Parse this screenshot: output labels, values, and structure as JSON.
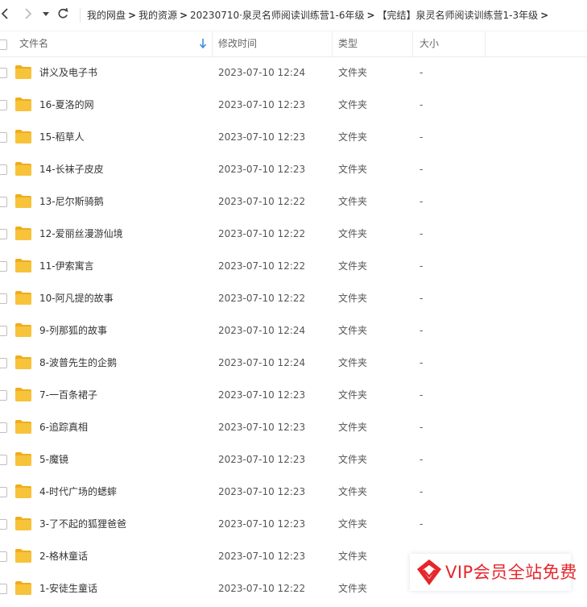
{
  "nav": {
    "back_icon": "chevron-left-icon",
    "forward_icon": "chevron-right-icon",
    "dropdown_icon": "caret-down-icon",
    "refresh_icon": "refresh-icon"
  },
  "breadcrumb": [
    "我的网盘",
    "我的资源",
    "20230710·泉灵名师阅读训练营1-6年级",
    "【完结】泉灵名师阅读训练营1-3年级"
  ],
  "columns": {
    "name": "文件名",
    "modified": "修改时间",
    "type": "类型",
    "size": "大小"
  },
  "rows": [
    {
      "name": "讲义及电子书",
      "modified": "2023-07-10 12:24",
      "type": "文件夹",
      "size": "-"
    },
    {
      "name": "16-夏洛的网",
      "modified": "2023-07-10 12:23",
      "type": "文件夹",
      "size": "-"
    },
    {
      "name": "15-稻草人",
      "modified": "2023-07-10 12:23",
      "type": "文件夹",
      "size": "-"
    },
    {
      "name": "14-长袜子皮皮",
      "modified": "2023-07-10 12:23",
      "type": "文件夹",
      "size": "-"
    },
    {
      "name": "13-尼尔斯骑鹅",
      "modified": "2023-07-10 12:22",
      "type": "文件夹",
      "size": "-"
    },
    {
      "name": "12-爱丽丝漫游仙境",
      "modified": "2023-07-10 12:22",
      "type": "文件夹",
      "size": "-"
    },
    {
      "name": "11-伊索寓言",
      "modified": "2023-07-10 12:22",
      "type": "文件夹",
      "size": "-"
    },
    {
      "name": "10-阿凡提的故事",
      "modified": "2023-07-10 12:22",
      "type": "文件夹",
      "size": "-"
    },
    {
      "name": "9-列那狐的故事",
      "modified": "2023-07-10 12:24",
      "type": "文件夹",
      "size": "-"
    },
    {
      "name": "8-波普先生的企鹅",
      "modified": "2023-07-10 12:24",
      "type": "文件夹",
      "size": "-"
    },
    {
      "name": "7-一百条裙子",
      "modified": "2023-07-10 12:23",
      "type": "文件夹",
      "size": "-"
    },
    {
      "name": "6-追踪真相",
      "modified": "2023-07-10 12:23",
      "type": "文件夹",
      "size": "-"
    },
    {
      "name": "5-魔镜",
      "modified": "2023-07-10 12:23",
      "type": "文件夹",
      "size": "-"
    },
    {
      "name": "4-时代广场的蟋蟀",
      "modified": "2023-07-10 12:23",
      "type": "文件夹",
      "size": "-"
    },
    {
      "name": "3-了不起的狐狸爸爸",
      "modified": "2023-07-10 12:23",
      "type": "文件夹",
      "size": "-"
    },
    {
      "name": "2-格林童话",
      "modified": "2023-07-10 12:23",
      "type": "文件夹",
      "size": "-"
    },
    {
      "name": "1-安徒生童话",
      "modified": "2023-07-10 12:22",
      "type": "文件夹",
      "size": "-"
    }
  ],
  "vip_badge": {
    "text": "VIP会员全站免费",
    "color": "#e6262b"
  },
  "colors": {
    "folder": "#f7c33a",
    "folder_dark": "#f0ac1b",
    "sort_arrow": "#3a8fe8"
  }
}
